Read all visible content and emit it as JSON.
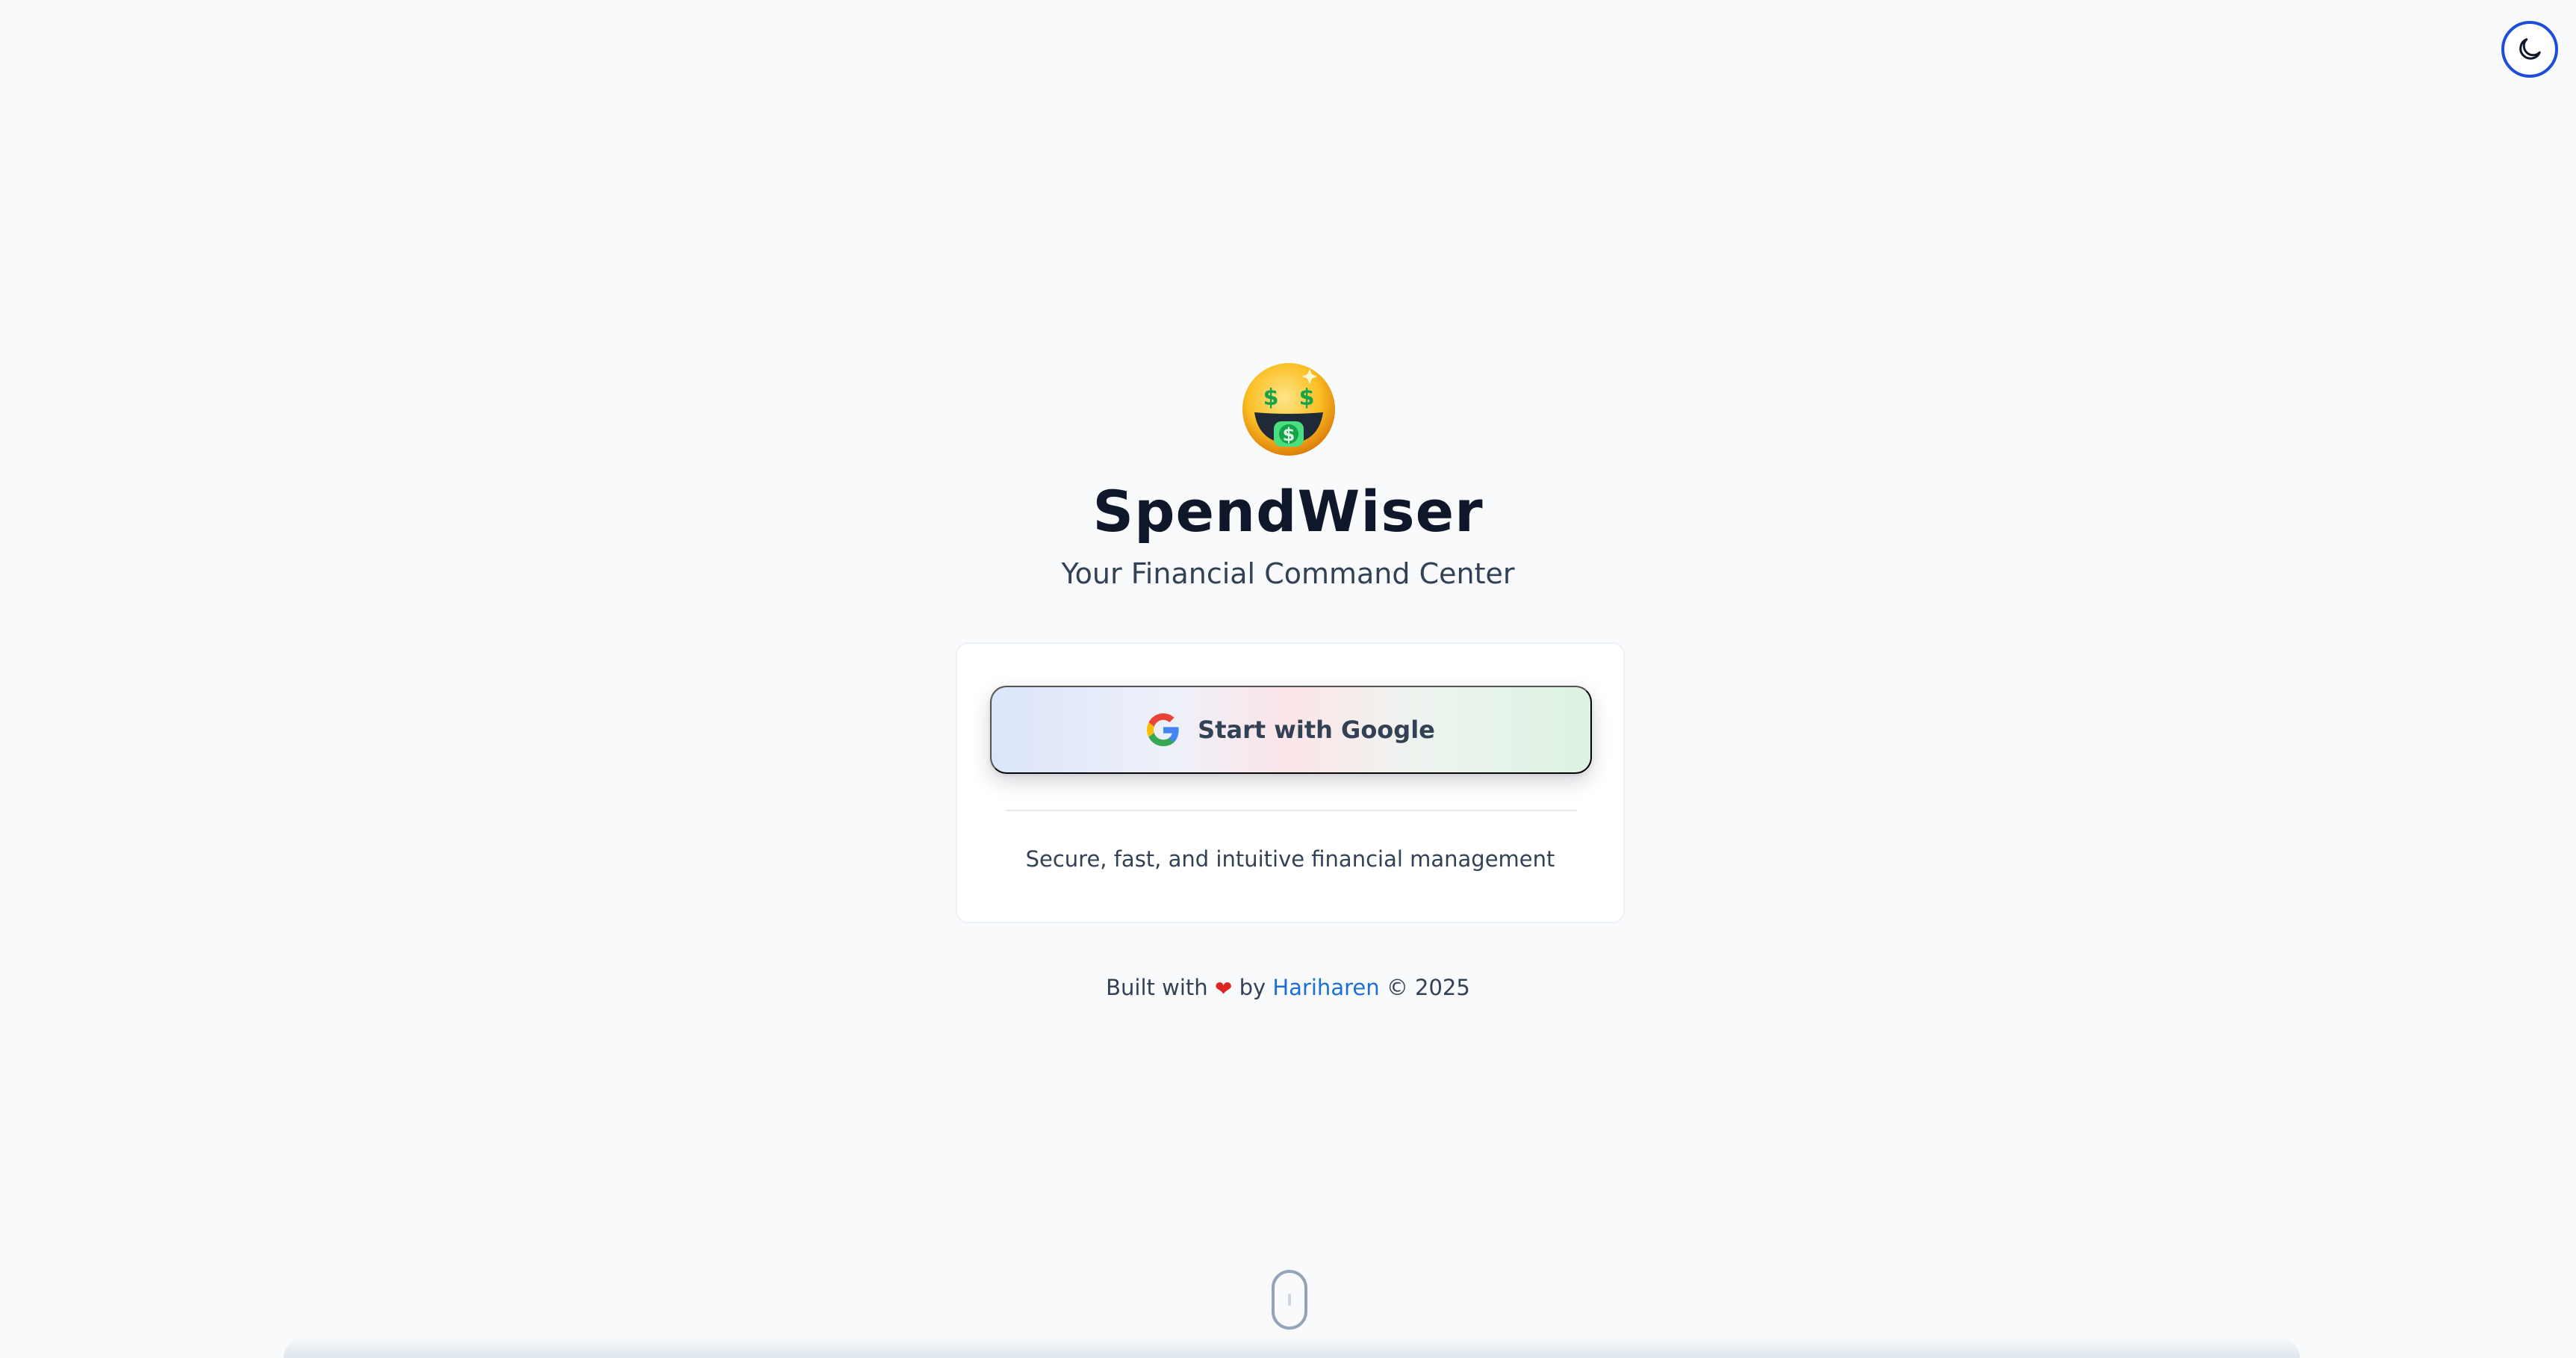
{
  "app": {
    "title": "SpendWiser",
    "tagline": "Your Financial Command Center",
    "logo_icon": "money-mouth-face-emoji"
  },
  "theme_toggle": {
    "icon": "moon-icon",
    "accent_color": "#1d4ed8"
  },
  "login_card": {
    "button_label": "Start with Google",
    "button_icon": "google-g-icon",
    "caption": "Secure, fast, and intuitive financial management"
  },
  "footer": {
    "prefix": "Built with",
    "heart_icon": "heart-icon",
    "by": "by",
    "author": "Hariharen",
    "copyright": "© 2025",
    "link_color": "#1d6fd6"
  },
  "scroll_indicator": {
    "icon": "mouse-scroll-icon"
  }
}
